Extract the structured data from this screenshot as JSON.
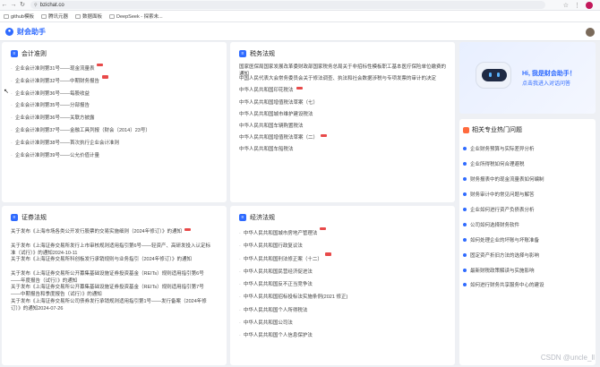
{
  "browser": {
    "url": "bzichat.co",
    "bookmarks": [
      "github模板",
      "腾讯元器",
      "数据面板",
      "DeepSeek - 探索未..."
    ]
  },
  "app": {
    "title": "财会助手"
  },
  "sections": {
    "accounting": {
      "title": "会计准则",
      "items": [
        "企业会计准则第31号——现金流量表",
        "企业会计准则第32号——中期财务报告",
        "企业会计准则第36号——每股收益",
        "企业会计准则第35号——分部报告",
        "企业会计准则第36号——关联方披露",
        "企业会计准则第37号——金融工具列报（财会〔2014〕23号）",
        "企业会计准则第38号——首次执行企业会计准则",
        "企业会计准则第39号——公允价值计量"
      ],
      "badges": [
        true,
        true,
        false,
        false,
        false,
        false,
        false,
        false
      ]
    },
    "tax": {
      "title": "税务法规",
      "items": [
        "国家医保局国家发展改革委财政部国家税务总局关于非招标性模板职工基本医疗保险单位缴费的通知",
        "中国人民代表大会常务委员会关于修法调查、执法和社会数据涉税与专项发票的审计的决定",
        "中华人民共和国印花税法",
        "中华人民共和国增值税法草案（七）",
        "中华人民共和国城市维护建设税法",
        "中华人民共和国车辆购置税法",
        "中华人民共和国增值税法草案（二）",
        "中华人民共和国车船税法"
      ],
      "badges": [
        false,
        false,
        true,
        false,
        false,
        false,
        true,
        false
      ]
    },
    "securities": {
      "title": "证券法规",
      "items": [
        "关于发布《上海市场各类公开发行股票的交易实施细则（2024年修订）》的通知",
        "关于发布《上海证券交易所发行上市审核规则适用指引第6号——轻资产、高研发投入认定标准（试行）》的通知2024-10-11",
        "关于发布《上海证券交易所科创板发行承销规则与业务指引（2024年修订）》的通知",
        "关于发布《上海证券交易所公开募集基础设施证券投资基金（REITs）规则适用指引第6号——年度报告（试行）》的通知",
        "关于发布《上海证券交易所公开募集基础设施证券投资基金（REITs）规则适用指引第7号——中期报告和季度报告（试行）》的通知",
        "关于发布《上海证券交易所公司债券发行承销规则适用指引第1号——发行备案（2024年修订）》的通知2024-07-26"
      ],
      "badges": [
        true,
        false,
        false,
        false,
        false,
        false
      ]
    },
    "economic": {
      "title": "经济法规",
      "items": [
        "中华人民共和国城市房地产管理法",
        "中华人民共和国行政复议法",
        "中华人民共和国刑法修正案（十二）",
        "中华人民共和国民营经济促进法",
        "中华人民共和国反不正当竞争法",
        "中华人民共和国招标投标法实施条例(2021 修正)",
        "中华人民共和国个人所得税法",
        "中华人民共和国公司法",
        "中华人民共和国个人信息保护法"
      ],
      "badges": [
        true,
        false,
        true,
        false,
        false,
        false,
        false,
        false,
        false
      ]
    }
  },
  "assistant": {
    "title": "Hi, 我是财会助手！",
    "subtitle": "点击我进入对话问答"
  },
  "hot": {
    "title": "相关专业热门问题",
    "items": [
      "企业财务预算与实际差异分析",
      "企业所得税如何合理避税",
      "财务报表中的现金流量表如何编制",
      "财务审计中的常见问题与解答",
      "企业如何进行资产负债表分析",
      "公司如何选择财务软件",
      "如何处理企业的坏账与坏账准备",
      "固定资产折旧方法的选择与影响",
      "最新财税政策解读与实施影响",
      "如何进行财务共享服务中心的建设"
    ]
  },
  "watermark": "CSDN @uncle_ll",
  "colors": {
    "accent": "#2f6bff",
    "badge": "#e84a4a",
    "hot_icon": "#ff6a3d"
  }
}
